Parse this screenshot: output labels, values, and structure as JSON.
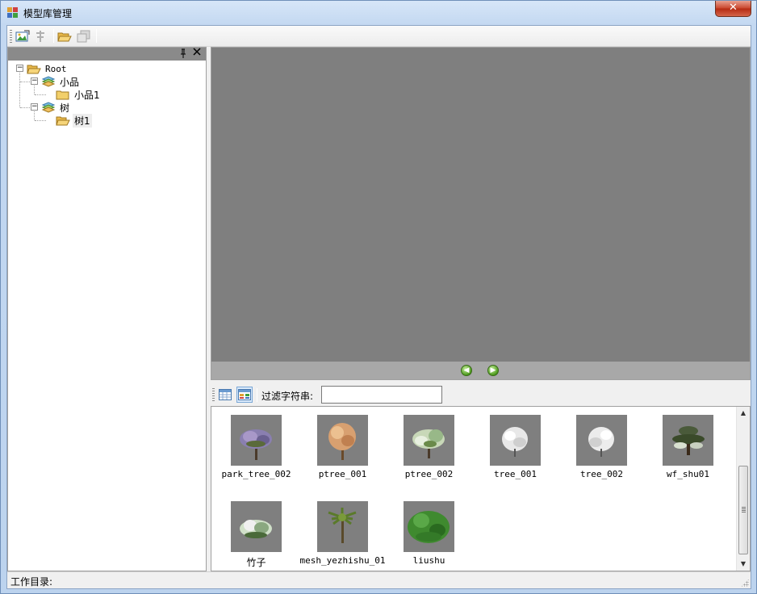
{
  "window": {
    "title": "模型库管理",
    "close_label": "✕"
  },
  "toolbar": {
    "buttons": [
      {
        "icon": "image-settings-icon"
      },
      {
        "icon": "disabled-tool-icon"
      },
      {
        "icon": "open-folder-icon"
      },
      {
        "icon": "disabled-copy-icon"
      }
    ]
  },
  "tree_panel": {
    "pin_icon": "pin-icon",
    "close_icon": "close-icon",
    "nodes": [
      {
        "label": "Root",
        "expander": "−",
        "icon": "open-folder-icon"
      },
      {
        "label": "小品",
        "expander": "−",
        "icon": "layers-icon"
      },
      {
        "label": "小品1",
        "icon": "folder-icon"
      },
      {
        "label": "树",
        "expander": "−",
        "icon": "layers-icon"
      },
      {
        "label": "树1",
        "icon": "open-folder-icon",
        "selected": true
      }
    ]
  },
  "viewer": {
    "prev_label": "◀",
    "next_label": "▶"
  },
  "filter": {
    "label": "过滤字符串:",
    "value": ""
  },
  "thumbnails": [
    {
      "label": "park_tree_002",
      "color": "#8a7fb0"
    },
    {
      "label": "ptree_001",
      "color": "#d8a070"
    },
    {
      "label": "ptree_002",
      "color": "#c8d8b8"
    },
    {
      "label": "tree_001",
      "color": "#e8e8e8"
    },
    {
      "label": "tree_002",
      "color": "#ececec"
    },
    {
      "label": "wf_shu01",
      "color": "#4a5a3a"
    },
    {
      "label": "竹子",
      "color": "#d0e0c8"
    },
    {
      "label": "mesh_yezhishu_01",
      "color": "#5a7a2a"
    },
    {
      "label": "liushu",
      "color": "#3f8a2f"
    }
  ],
  "status": {
    "label": "工作目录:"
  }
}
